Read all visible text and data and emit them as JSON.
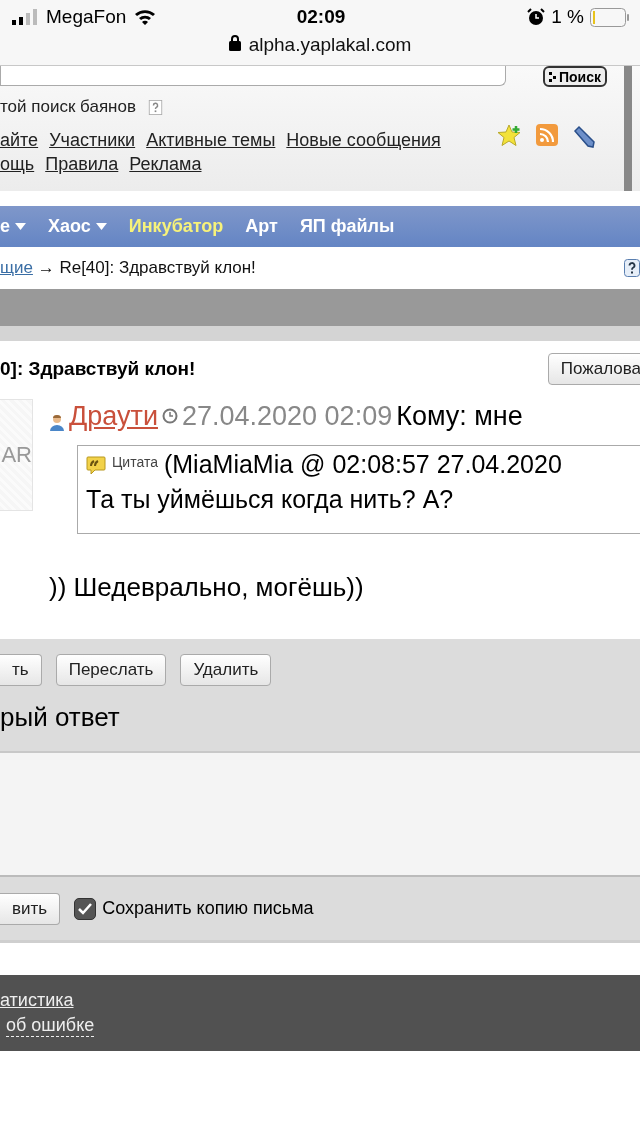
{
  "status_bar": {
    "carrier": "MegaFon",
    "time": "02:09",
    "battery": "1 %"
  },
  "browser": {
    "url": "alpha.yaplakal.com"
  },
  "search": {
    "button": "Поиск",
    "option": "той поиск баянов"
  },
  "top_link_rows": [
    [
      "айте",
      "Участники",
      "Активные темы",
      "Новые сообщения"
    ],
    [
      "ощь",
      "Правила",
      "Реклама"
    ]
  ],
  "nav": [
    {
      "label": "е",
      "dropdown": true,
      "selected": false
    },
    {
      "label": "Хаос",
      "dropdown": true,
      "selected": false
    },
    {
      "label": "Инкубатор",
      "dropdown": false,
      "selected": true
    },
    {
      "label": "Арт",
      "dropdown": false,
      "selected": false
    },
    {
      "label": "ЯП файлы",
      "dropdown": false,
      "selected": false
    }
  ],
  "breadcrumb": {
    "link": "щие",
    "current": "→ Re[40]: Здравствуй клон!"
  },
  "message": {
    "title": "0]: Здравствуй клон!",
    "report_button": "Пожалова",
    "avatar_text": "AR",
    "author": "Драути",
    "date": "27.04.2020 02:09",
    "recipient": "Кому: мне",
    "quote": {
      "label": "Цитата",
      "source": "(MiaMiaMia @ 02:08:57 27.04.2020",
      "text": "Та ты уймёшься когда нить? А?"
    },
    "body": ")) Шедеврально, могёшь))"
  },
  "actions": [
    "ть",
    "Переслать",
    "Удалить"
  ],
  "quick_reply": {
    "title": "рый ответ",
    "submit": "вить",
    "save_copy": {
      "label": "Сохранить копию письма",
      "checked": true
    }
  },
  "footer": {
    "links": [
      {
        "label": "атистика",
        "kind": "link"
      },
      {
        "label": "об ошибке",
        "kind": "dashed"
      }
    ]
  }
}
